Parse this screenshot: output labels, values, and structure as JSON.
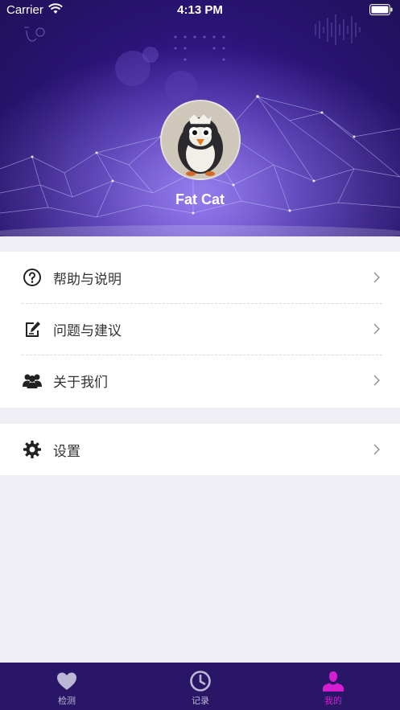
{
  "status_bar": {
    "carrier": "Carrier",
    "time": "4:13 PM"
  },
  "profile": {
    "username": "Fat Cat"
  },
  "menu": {
    "group1": [
      {
        "label": "帮助与说明",
        "icon": "help-circle-icon"
      },
      {
        "label": "问题与建议",
        "icon": "edit-note-icon"
      },
      {
        "label": "关于我们",
        "icon": "users-icon"
      }
    ],
    "group2": [
      {
        "label": "设置",
        "icon": "gear-icon"
      }
    ]
  },
  "tabbar": {
    "tabs": [
      {
        "label": "检测",
        "icon": "heart-icon",
        "active": false
      },
      {
        "label": "记录",
        "icon": "clock-icon",
        "active": false
      },
      {
        "label": "我的",
        "icon": "person-icon",
        "active": true
      }
    ]
  },
  "colors": {
    "accent": "#d51ecf",
    "header_bg": "#2a1477",
    "tabbar_bg": "#2a1666"
  }
}
